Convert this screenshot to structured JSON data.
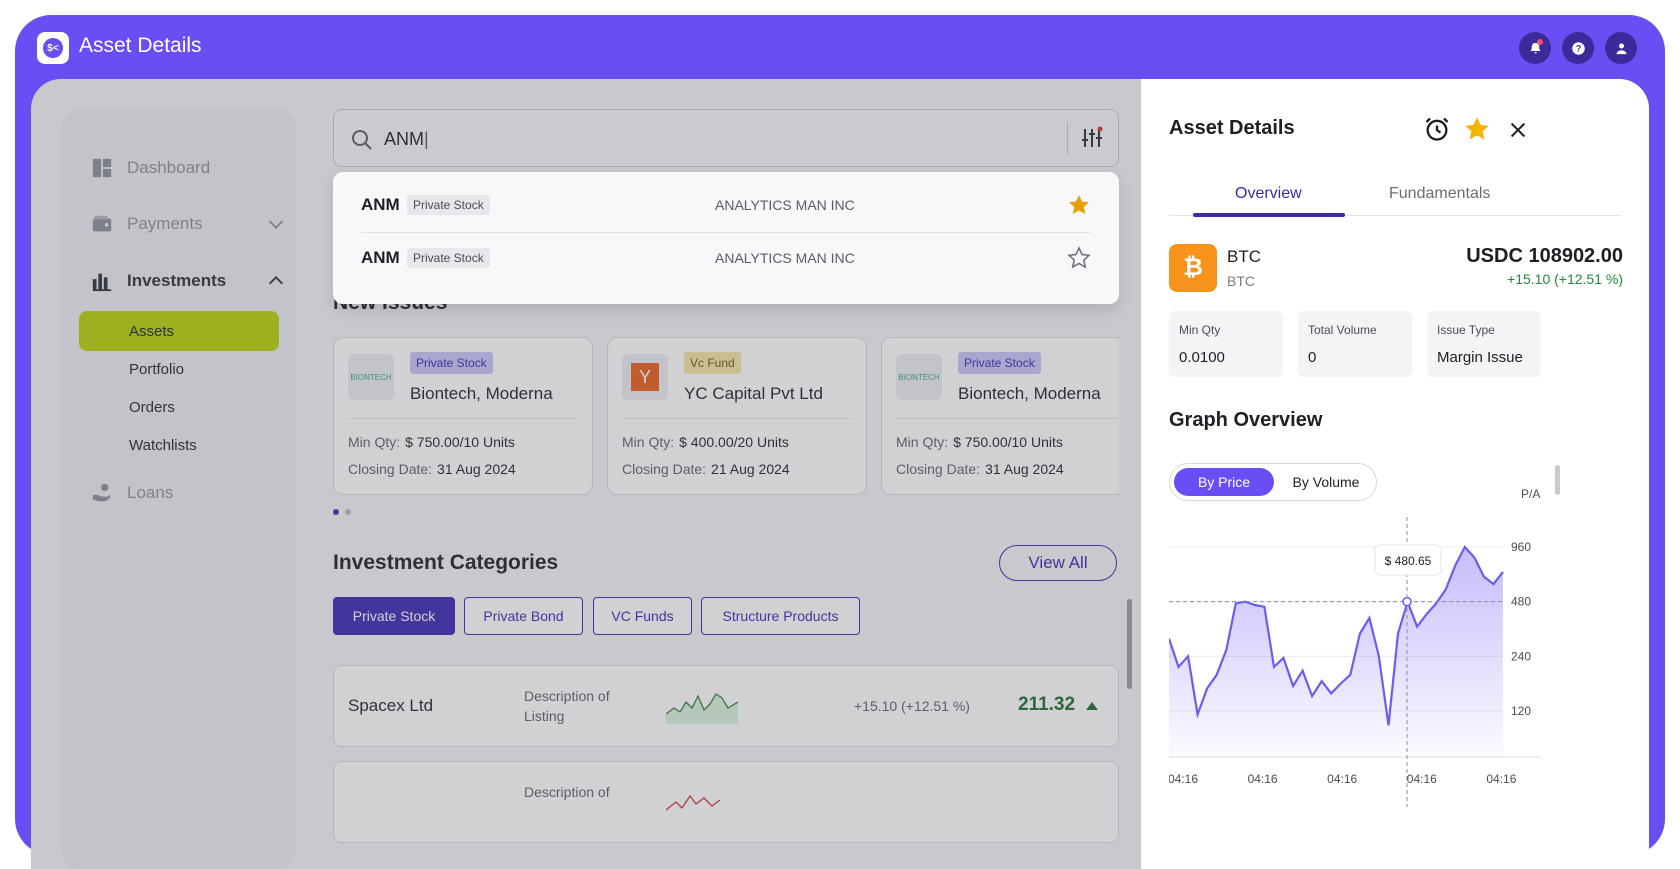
{
  "app": {
    "title": "Asset Details"
  },
  "sidebar": {
    "items": [
      {
        "label": "Dashboard",
        "icon": "dashboard-icon"
      },
      {
        "label": "Payments",
        "icon": "wallet-icon"
      },
      {
        "label": "Investments",
        "icon": "bar-chart-icon"
      },
      {
        "label": "Loans",
        "icon": "hand-coin-icon"
      }
    ],
    "subitems": [
      "Assets",
      "Portfolio",
      "Orders",
      "Watchlists"
    ]
  },
  "search": {
    "value": "ANM"
  },
  "dropdown": [
    {
      "symbol": "ANM",
      "type": "Private Stock",
      "name": "ANALYTICS MAN INC",
      "starred": true
    },
    {
      "symbol": "ANM",
      "type": "Private Stock",
      "name": "ANALYTICS MAN INC",
      "starred": false
    }
  ],
  "new_issues": {
    "title": "New Issues",
    "cards": [
      {
        "badge": "Private Stock",
        "name": "Biontech, Moderna",
        "min_qty_label": "Min Qty:",
        "min_qty": "$ 750.00/10 Units",
        "closing_label": "Closing Date:",
        "closing": "31 Aug 2024",
        "logo": "BIONTECH"
      },
      {
        "badge": "Vc Fund",
        "name": "YC Capital Pvt Ltd",
        "min_qty_label": "Min Qty:",
        "min_qty": "$ 400.00/20 Units",
        "closing_label": "Closing Date:",
        "closing": "21 Aug 2024",
        "logo": "Y"
      },
      {
        "badge": "Private Stock",
        "name": "Biontech, Moderna",
        "min_qty_label": "Min Qty:",
        "min_qty": "$ 750.00/10 Units",
        "closing_label": "Closing Date:",
        "closing": "31 Aug 2024",
        "logo": "BIONTECH"
      }
    ]
  },
  "categories": {
    "title": "Investment Categories",
    "view_all": "View All",
    "tabs": [
      "Private Stock",
      "Private Bond",
      "VC Funds",
      "Structure Products"
    ]
  },
  "listings": [
    {
      "name": "Spacex Ltd",
      "description": "Description of Listing",
      "change": "+15.10 (+12.51 %)",
      "price": "211.32"
    },
    {
      "name": "",
      "description": "Description of",
      "change": "",
      "price": ""
    }
  ],
  "panel": {
    "title": "Asset Details",
    "tabs": [
      "Overview",
      "Fundamentals"
    ],
    "asset": {
      "symbol": "BTC",
      "sub": "BTC",
      "price": "USDC 108902.00",
      "change": "+15.10 (+12.51 %)"
    },
    "stats": [
      {
        "label": "Min Qty",
        "value": "0.0100"
      },
      {
        "label": "Total Volume",
        "value": "0"
      },
      {
        "label": "Issue Type",
        "value": "Margin Issue"
      }
    ],
    "graph_title": "Graph Overview",
    "toggle": [
      "By Price",
      "By Volume"
    ],
    "y_unit": "P/A"
  },
  "colors": {
    "brand": "#6a4df3",
    "accent": "#3a28b0",
    "lime": "#b7d105",
    "btc": "#f7931a",
    "up": "#1f8a3a"
  },
  "chart_data": {
    "type": "area",
    "yticks": [
      120,
      240,
      480,
      960
    ],
    "xticks": [
      "04:16",
      "04:16",
      "04:16",
      "04:16",
      "04:16"
    ],
    "tooltip": "$ 480.65",
    "values": [
      300,
      210,
      240,
      115,
      160,
      190,
      260,
      470,
      480,
      460,
      450,
      210,
      235,
      165,
      200,
      145,
      175,
      150,
      170,
      190,
      320,
      390,
      240,
      100,
      320,
      480,
      350,
      410,
      470,
      560,
      760,
      960,
      840,
      660,
      600,
      700
    ]
  }
}
